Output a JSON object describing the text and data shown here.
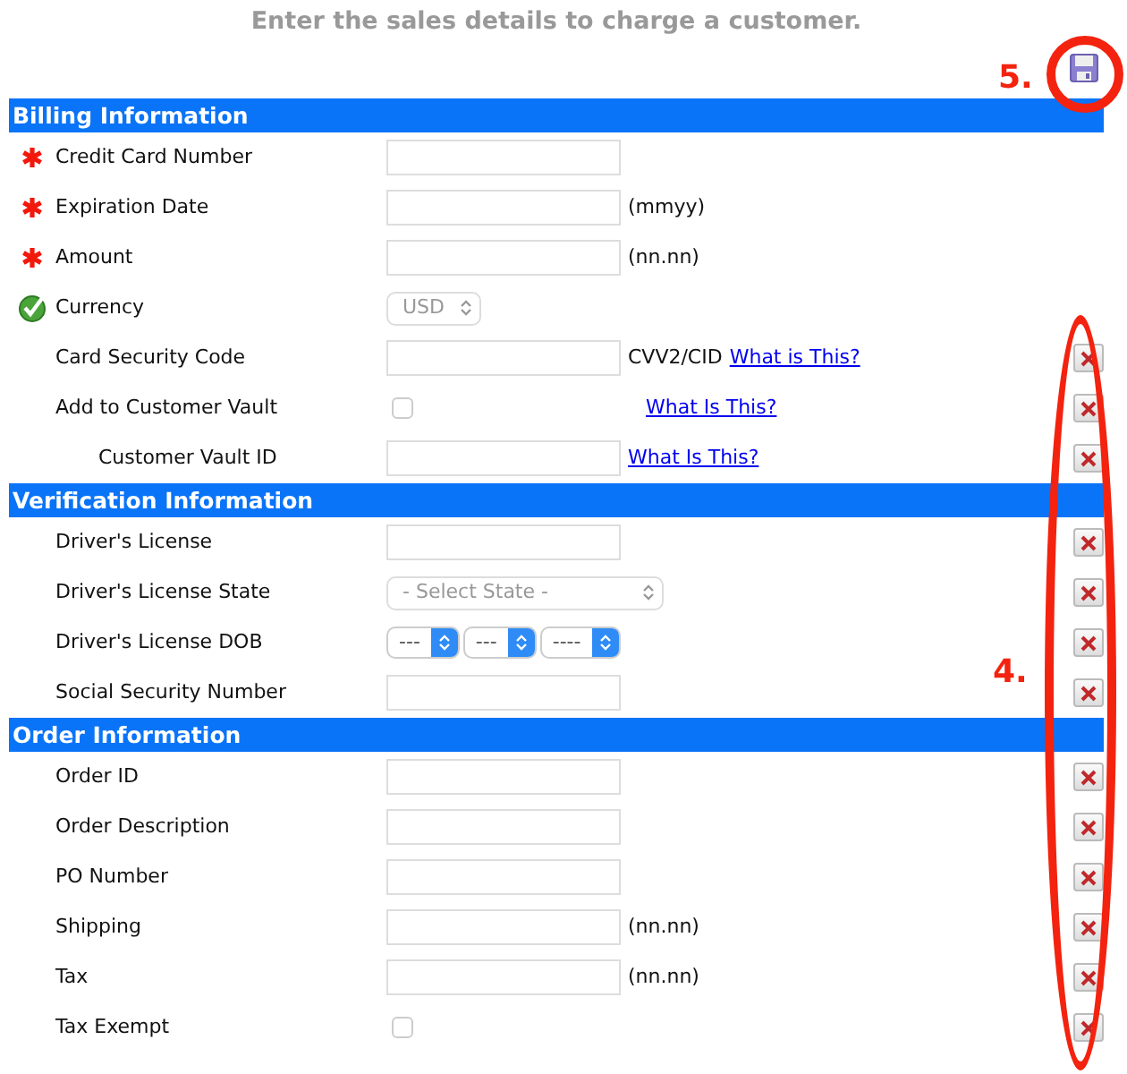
{
  "heading": "Enter the sales details to charge a customer.",
  "sections": [
    {
      "title": "Billing Information",
      "rows": [
        {
          "label": "Credit Card Number",
          "required": true,
          "kind": "text",
          "removable": false
        },
        {
          "label": "Expiration Date",
          "required": true,
          "kind": "text",
          "suffix": "(mmyy)",
          "removable": false
        },
        {
          "label": "Amount",
          "required": true,
          "kind": "text",
          "suffix": "(nn.nn)",
          "removable": false
        },
        {
          "label": "Currency",
          "valid": true,
          "kind": "select",
          "value": "USD",
          "disabled": true,
          "removable": false
        },
        {
          "label": "Card Security Code",
          "kind": "text",
          "suffix": "CVV2/CID",
          "link": "What is This?",
          "removable": true
        },
        {
          "label": "Add to Customer Vault",
          "kind": "checkbox",
          "checked": false,
          "link": "What Is This?",
          "removable": true
        },
        {
          "label": "Customer Vault ID",
          "indented": true,
          "kind": "text",
          "link": "What Is This?",
          "removable": true
        }
      ]
    },
    {
      "title": "Verification Information",
      "rows": [
        {
          "label": "Driver's License",
          "kind": "text",
          "removable": true
        },
        {
          "label": "Driver's License State",
          "kind": "select",
          "value": "- Select State -",
          "disabled": true,
          "removable": true
        },
        {
          "label": "Driver's License DOB",
          "kind": "dob",
          "parts": [
            "---",
            "---",
            "----"
          ],
          "removable": true
        },
        {
          "label": "Social Security Number",
          "kind": "text",
          "removable": true
        }
      ]
    },
    {
      "title": "Order Information",
      "rows": [
        {
          "label": "Order ID",
          "kind": "text",
          "removable": true
        },
        {
          "label": "Order Description",
          "kind": "text",
          "removable": true
        },
        {
          "label": "PO Number",
          "kind": "text",
          "removable": true
        },
        {
          "label": "Shipping",
          "kind": "text",
          "suffix": "(nn.nn)",
          "removable": true
        },
        {
          "label": "Tax",
          "kind": "text",
          "suffix": "(nn.nn)",
          "removable": true
        },
        {
          "label": "Tax Exempt",
          "kind": "checkbox",
          "checked": false,
          "removable": true
        }
      ]
    }
  ],
  "annotations": [
    {
      "kind": "circle",
      "label": "5."
    },
    {
      "kind": "ellipse",
      "label": "4."
    }
  ]
}
